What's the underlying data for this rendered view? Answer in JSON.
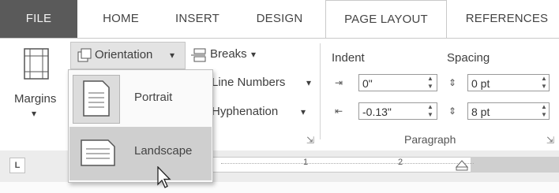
{
  "tabs": {
    "file": "FILE",
    "home": "HOME",
    "insert": "INSERT",
    "design": "DESIGN",
    "page_layout": "PAGE LAYOUT",
    "references": "REFERENCES"
  },
  "ribbon": {
    "margins": "Margins",
    "orientation": "Orientation",
    "breaks": "Breaks",
    "line_numbers": "Line Numbers",
    "hyphenation": "Hyphenation",
    "indent_label": "Indent",
    "spacing_label": "Spacing",
    "indent_left": "0\"",
    "indent_right": "-0.13\"",
    "spacing_before": "0 pt",
    "spacing_after": "8 pt",
    "paragraph_group": "Paragraph"
  },
  "orientation_menu": {
    "portrait": "Portrait",
    "landscape": "Landscape",
    "highlighted": "Landscape"
  },
  "ruler": {
    "tick_1": "1",
    "tick_2": "2",
    "tab_selector": "L"
  },
  "colors": {
    "file_tab_bg": "#5a5a5a",
    "highlight": "#cfcfcf"
  }
}
